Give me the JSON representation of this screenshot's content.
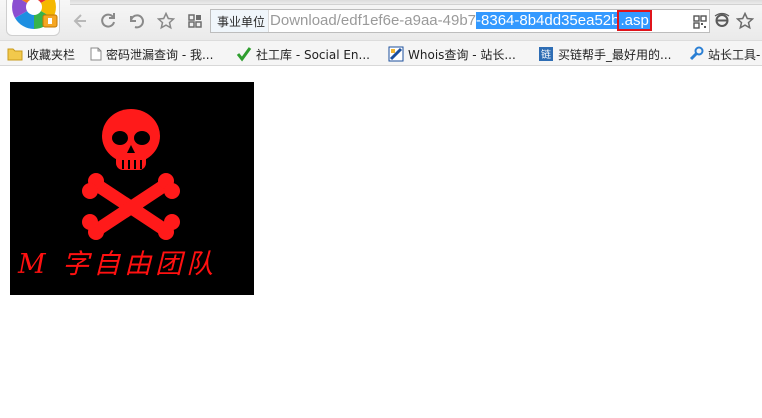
{
  "browser": {
    "logo_icon": "browser-logo-icon",
    "nav_icons": [
      "back-icon",
      "refresh-icon",
      "undo-icon",
      "favorite-star-icon",
      "apps-grid-icon"
    ],
    "address_bar": {
      "badge": "事业单位",
      "url_plain": "Download/edf1ef6e-a9aa-49b7",
      "url_selected": "-8364-8b4dd35ea52b",
      "url_extension": ".asp",
      "selection_color": "#3399ff",
      "highlight_box_color": "#e0141b"
    },
    "right_icons": [
      "qr-code-icon",
      "ie-mode-icon",
      "bookmark-star-icon"
    ]
  },
  "bookmarks": [
    {
      "label": "收藏夹栏",
      "icon": "folder-icon"
    },
    {
      "label": "密码泄漏查询 - 我...",
      "icon": "page-icon"
    },
    {
      "label": "社工库 - Social En...",
      "icon": "green-check-icon"
    },
    {
      "label": "Whois查询 - 站长...",
      "icon": "whois-icon"
    },
    {
      "label": "买链帮手_最好用的...",
      "icon": "link-icon"
    },
    {
      "label": "站长工具-",
      "icon": "tools-icon"
    }
  ],
  "content": {
    "image_icon": "skull-crossbones-icon",
    "team_name": "M 字自由团队",
    "image_bg": "#000000",
    "accent": "#ff1010"
  }
}
